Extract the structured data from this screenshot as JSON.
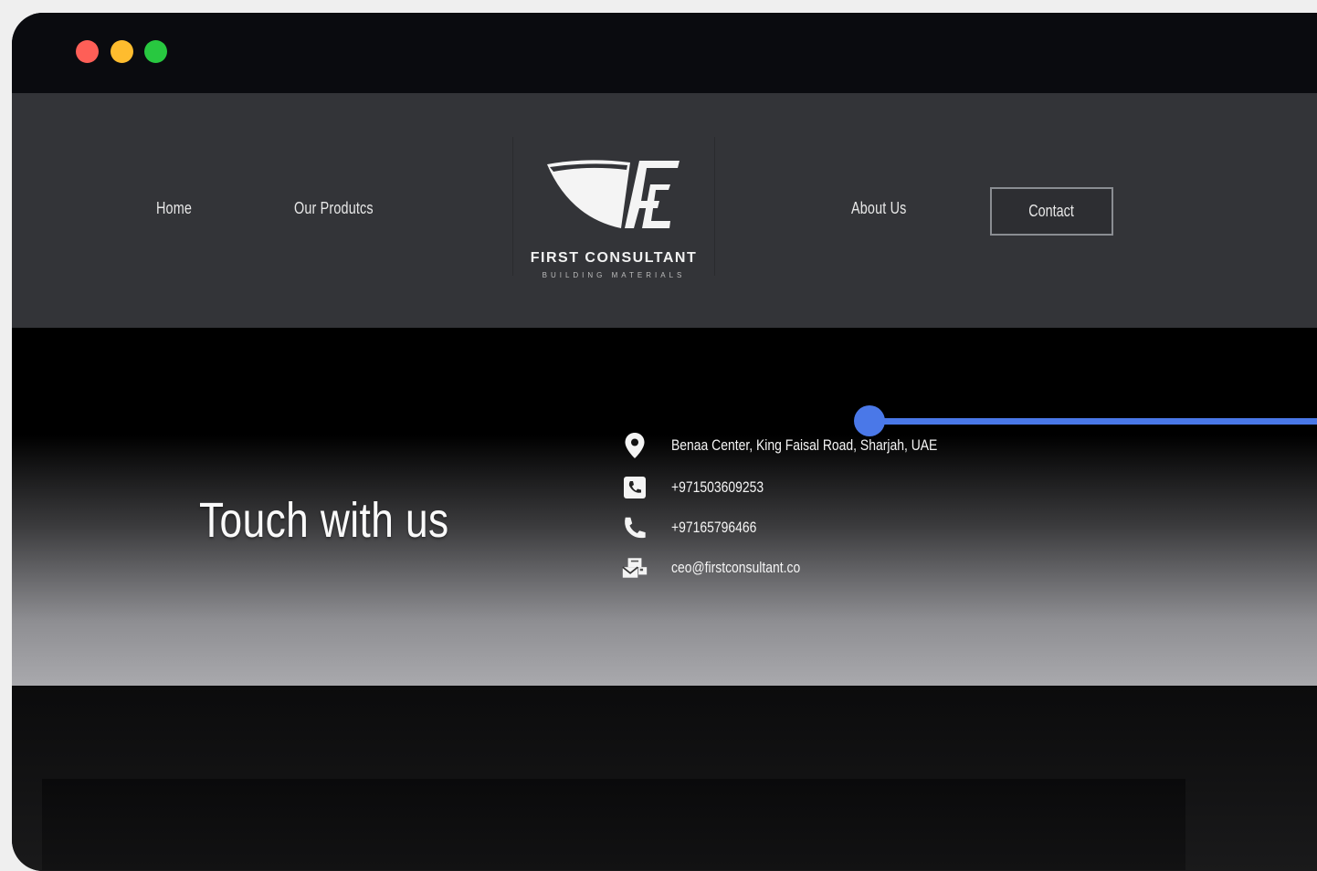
{
  "window": {
    "controls": [
      "close",
      "minimize",
      "maximize"
    ]
  },
  "nav": {
    "home": "Home",
    "products": "Our Produtcs",
    "about": "About Us",
    "contact": "Contact"
  },
  "logo": {
    "name": "FIRST CONSULTANT",
    "tagline": "BUILDING MATERIALS"
  },
  "hero": {
    "title": "Touch with us",
    "contact_items": [
      {
        "icon": "map-pin-icon",
        "text": "Benaa Center, King Faisal Road, Sharjah, UAE"
      },
      {
        "icon": "mobile-phone-icon",
        "text": "+971503609253"
      },
      {
        "icon": "phone-icon",
        "text": "+97165796466"
      },
      {
        "icon": "email-icon",
        "text": "ceo@firstconsultant.co"
      }
    ]
  },
  "colors": {
    "accent": "#4a78e8",
    "navbar": "#333438",
    "titlebar": "#0a0b0f"
  }
}
